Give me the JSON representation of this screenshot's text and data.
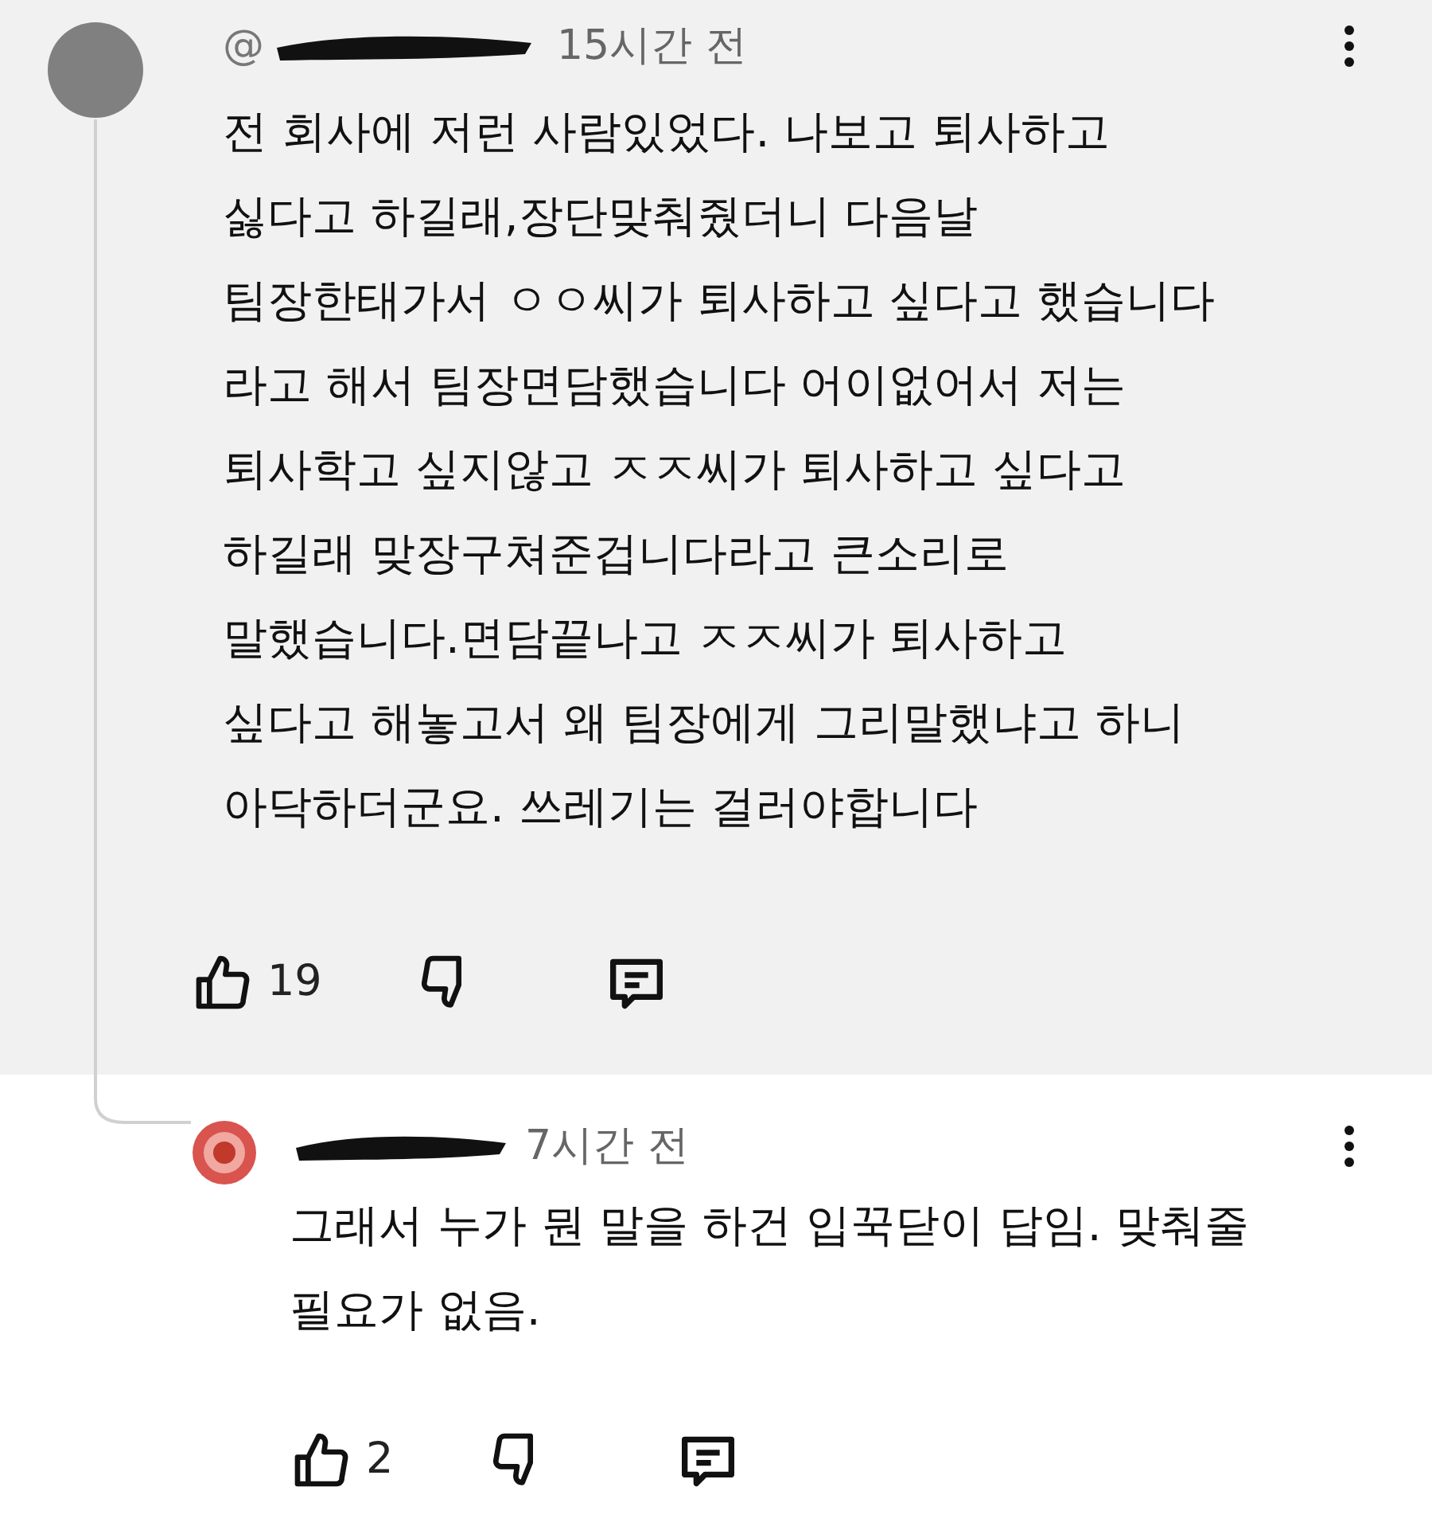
{
  "comment": {
    "username": "@",
    "redacted": true,
    "time": "15시간 전",
    "body_lines": [
      "전 회사에 저런 사람있었다. 나보고 퇴사하고",
      "싫다고 하길래,장단맞춰줬더니 다음날",
      "팀장한태가서 ㅇㅇ씨가 퇴사하고 싶다고 했습니다",
      "라고 해서 팀장면담했습니다 어이없어서 저는",
      "퇴사학고 싶지않고 ㅈㅈ씨가 퇴사하고 싶다고",
      "하길래 맞장구쳐준겁니다라고 큰소리로",
      "말했습니다.면담끝나고 ㅈㅈ씨가 퇴사하고",
      "싶다고 해놓고서 왜 팀장에게 그리말했냐고 하니",
      "아닥하더군요. 쓰레기는 걸러야합니다"
    ],
    "likes": "19"
  },
  "reply": {
    "redacted": true,
    "time": "7시간 전",
    "body_lines": [
      "그래서 누가 뭔 말을 하건 입꾹닫이 답임. 맞춰줄",
      "필요가 없음."
    ],
    "likes": "2"
  }
}
